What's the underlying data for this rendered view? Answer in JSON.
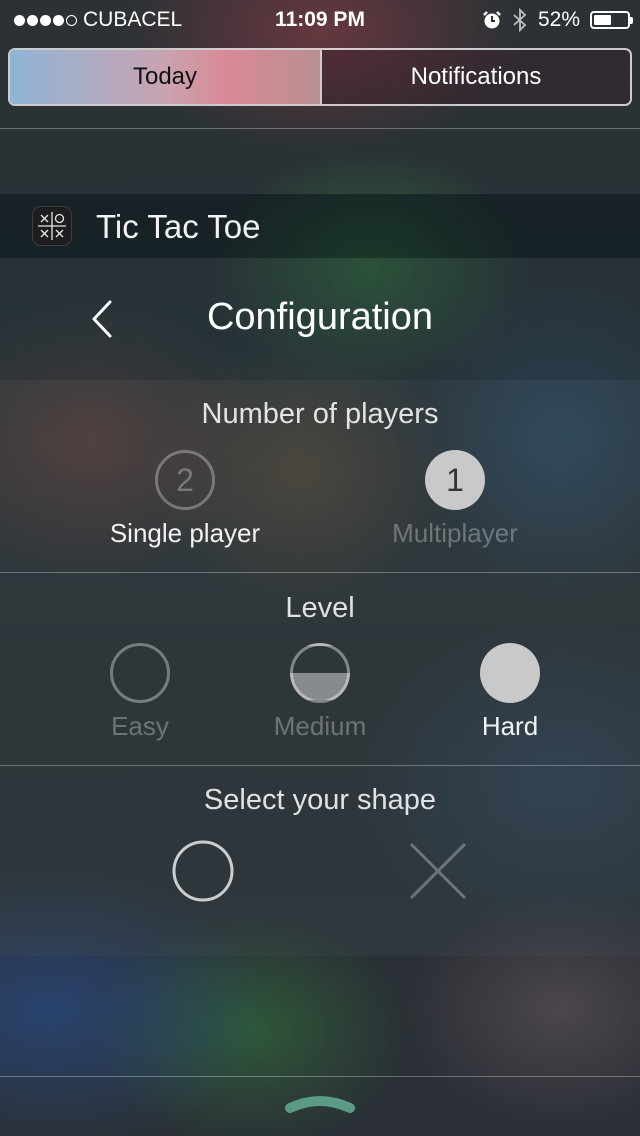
{
  "status_bar": {
    "carrier": "CUBACEL",
    "signal_bars_filled": 4,
    "signal_bars_total": 5,
    "time": "11:09 PM",
    "battery_percent": "52%",
    "battery_level": 0.52,
    "icons": [
      "alarm-icon",
      "bluetooth-icon",
      "battery-icon"
    ]
  },
  "tabs": {
    "today": "Today",
    "notifications": "Notifications",
    "selected": "Today"
  },
  "widget": {
    "app_name": "Tic Tac Toe",
    "icon": "tic-tac-toe-app-icon",
    "nav": {
      "back_icon": "chevron-left-icon",
      "title": "Configuration"
    },
    "players": {
      "title": "Number of players",
      "options": [
        {
          "label": "Single player",
          "badge": "2",
          "selected": false
        },
        {
          "label": "Multiplayer",
          "badge": "1",
          "selected": true
        }
      ]
    },
    "level": {
      "title": "Level",
      "options": [
        {
          "label": "Easy",
          "icon": "empty-circle-icon",
          "selected": false
        },
        {
          "label": "Medium",
          "icon": "half-circle-icon",
          "selected": false
        },
        {
          "label": "Hard",
          "icon": "full-circle-icon",
          "selected": true
        }
      ]
    },
    "shape": {
      "title": "Select your shape",
      "options": [
        {
          "name": "circle",
          "icon": "circle-shape-icon",
          "selected": true
        },
        {
          "name": "cross",
          "icon": "cross-shape-icon",
          "selected": false
        }
      ]
    }
  },
  "footer": {
    "grabber_icon": "chevron-up-handle-icon"
  },
  "colors": {
    "segment_active_gradient": [
      "#8fb5d6",
      "#d88a95"
    ],
    "selected_fill": "#c9c9c9",
    "grabber": "#5a9a86"
  }
}
